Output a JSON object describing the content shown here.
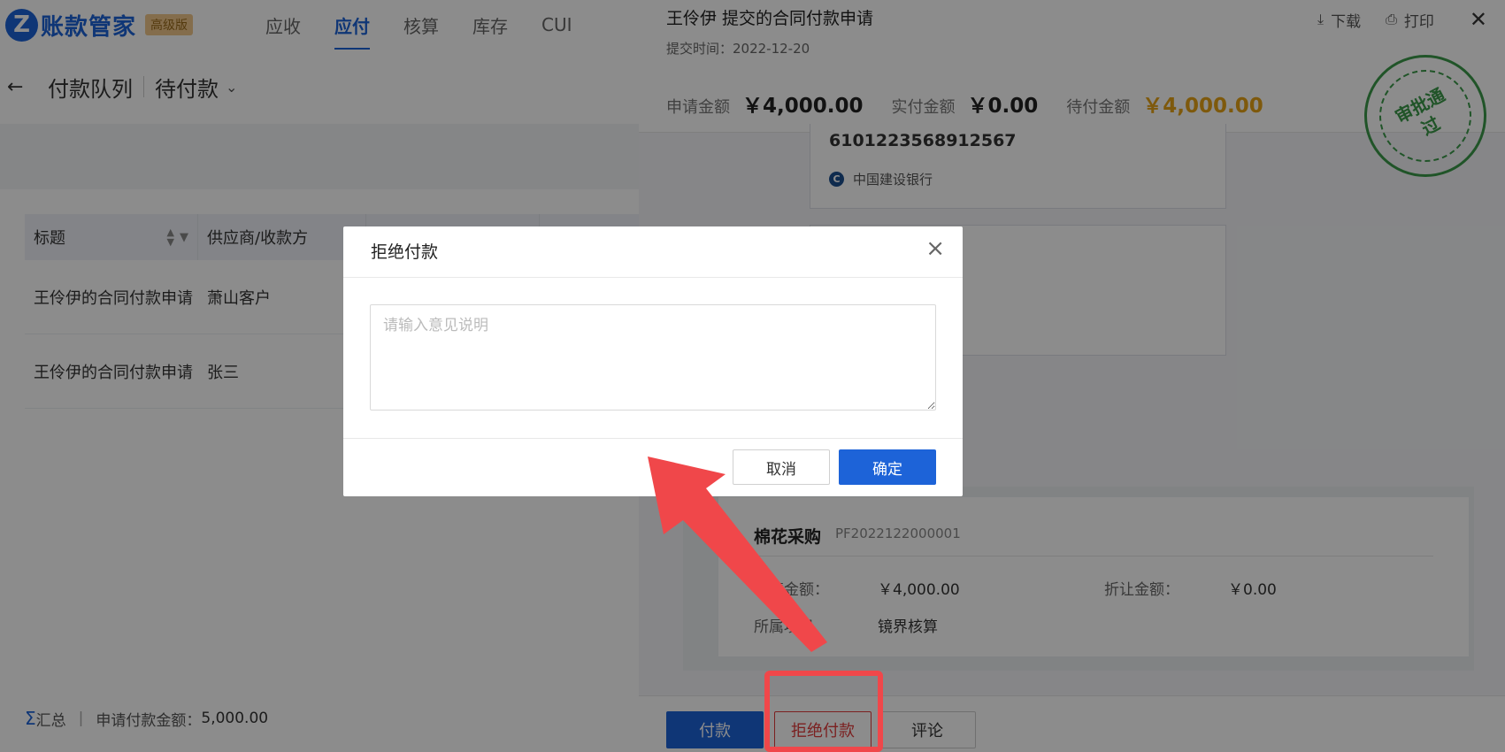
{
  "app": {
    "logo_mark": "Z",
    "name": "账款管家",
    "edition": "高级版"
  },
  "nav": {
    "items": [
      "应收",
      "应付",
      "核算",
      "库存",
      "CUI"
    ],
    "active": "应付"
  },
  "page": {
    "back_icon": "arrow-left-icon",
    "title": "付款队列",
    "filter": "待付款"
  },
  "table": {
    "headers": [
      "标题",
      "供应商/收款方"
    ],
    "rows": [
      {
        "title": "王伶伊的合同付款申请",
        "vendor": "萧山客户"
      },
      {
        "title": "王伶伊的合同付款申请",
        "vendor": "张三"
      }
    ]
  },
  "summary": {
    "label": "汇总",
    "metric_label": "申请付款金额：",
    "metric_value": "5,000.00"
  },
  "drawer": {
    "title": "王伶伊 提交的合同付款申请",
    "submit_time": "提交时间：2022-12-20",
    "actions": {
      "download": "下载",
      "print": "打印"
    },
    "amounts": [
      {
        "label": "申请金额",
        "value": "￥4,000.00"
      },
      {
        "label": "实付金额",
        "value": "￥0.00"
      },
      {
        "label": "待付金额",
        "value": "￥4,000.00"
      }
    ],
    "stamp": "审批通过",
    "bank": {
      "account": "6101223568912567",
      "name": "中国建设银行"
    },
    "contract": {
      "name": "棉花采购",
      "code": "PF2022122000001",
      "apply_label": "申请金额：",
      "apply_value": "￥4,000.00",
      "discount_label": "折让金额：",
      "discount_value": "￥0.00",
      "project_label": "所属项目",
      "project_value": "镜界核算"
    },
    "footer": {
      "pay": "付款",
      "reject": "拒绝付款",
      "comment": "评论"
    }
  },
  "modal": {
    "title": "拒绝付款",
    "placeholder": "请输入意见说明",
    "cancel": "取消",
    "confirm": "确定"
  },
  "colors": {
    "primary": "#1d63d8",
    "warning": "#e6a317",
    "danger": "#e03b3b",
    "stamp": "#3b9a4a",
    "annotation": "#f0474a"
  }
}
